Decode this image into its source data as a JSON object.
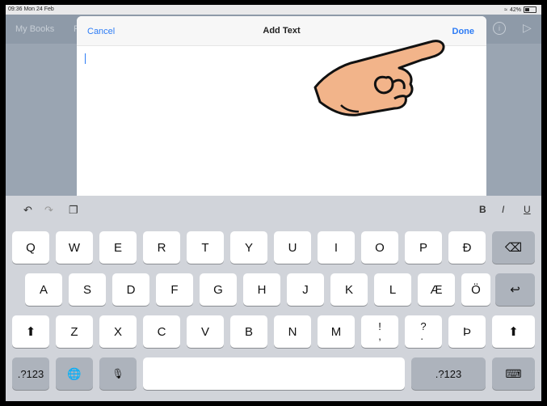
{
  "status_bar": {
    "time": "09:36  Mon 24 Feb",
    "battery": "42%"
  },
  "app": {
    "back_label": "My Books",
    "partial_label": "F",
    "info_glyph": "i",
    "play_glyph": "▷"
  },
  "modal": {
    "cancel_label": "Cancel",
    "title": "Add Text",
    "done_label": "Done"
  },
  "toolbar": {
    "undo": "↶",
    "redo": "↷",
    "paste": "❐",
    "bold": "B",
    "italic": "I",
    "underline": "U"
  },
  "keyboard": {
    "row1": [
      "Q",
      "W",
      "E",
      "R",
      "T",
      "Y",
      "U",
      "I",
      "O",
      "P",
      "Đ"
    ],
    "row2": [
      "A",
      "S",
      "D",
      "F",
      "G",
      "H",
      "J",
      "K",
      "L",
      "Æ",
      "Ö"
    ],
    "row3": [
      "Z",
      "X",
      "C",
      "V",
      "B",
      "N",
      "M",
      "!\n,",
      "?\n.",
      "Þ"
    ],
    "backspace": "⌫",
    "return": "↩",
    "shift": "⬆",
    "numbers_left": ".?123",
    "numbers_right": ".?123",
    "globe": "🌐",
    "mic": "🎙",
    "dismiss": "⌨"
  }
}
